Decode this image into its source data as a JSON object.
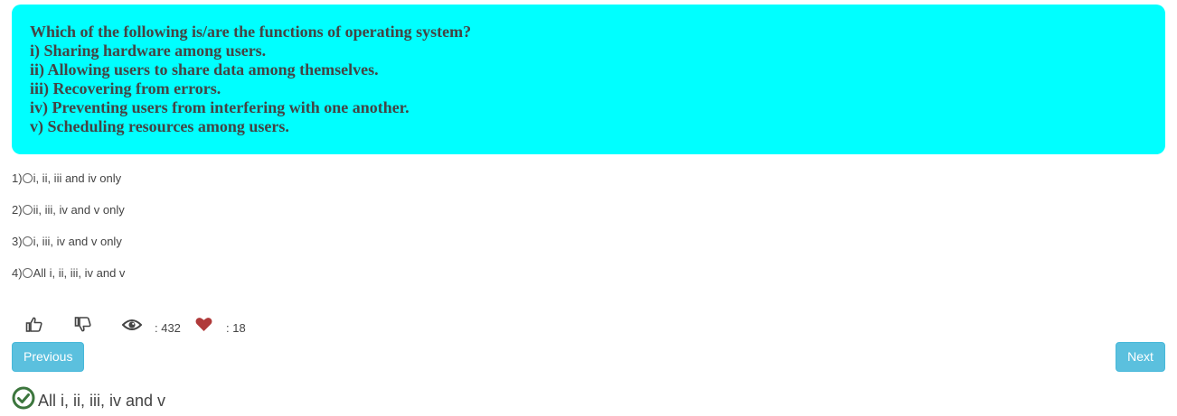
{
  "question": {
    "lines": [
      "Which of the following is/are the functions of operating system?",
      "i) Sharing hardware among users.",
      "ii) Allowing users to share data among themselves.",
      "iii) Recovering from errors.",
      "iv) Preventing users from interfering with one another.",
      "v) Scheduling resources among users."
    ]
  },
  "options": [
    {
      "number": "1)",
      "label": "i, ii, iii and iv only"
    },
    {
      "number": "2)",
      "label": "ii, iii, iv and v only"
    },
    {
      "number": "3)",
      "label": "i, iii, iv and v only"
    },
    {
      "number": "4)",
      "label": "All i, ii, iii, iv and v"
    }
  ],
  "stats": {
    "views": ": 432",
    "likes": ": 18"
  },
  "nav": {
    "previous": "Previous",
    "next": "Next"
  },
  "answer": {
    "text": "All i, ii, iii, iv and v"
  },
  "colors": {
    "question_bg": "#00ffff",
    "button_bg": "#5bc0de",
    "heart": "#b03a3a",
    "check": "#3c763d"
  },
  "icons": [
    "thumbs-up-icon",
    "thumbs-down-icon",
    "eye-icon",
    "heart-icon",
    "check-circle-icon"
  ]
}
